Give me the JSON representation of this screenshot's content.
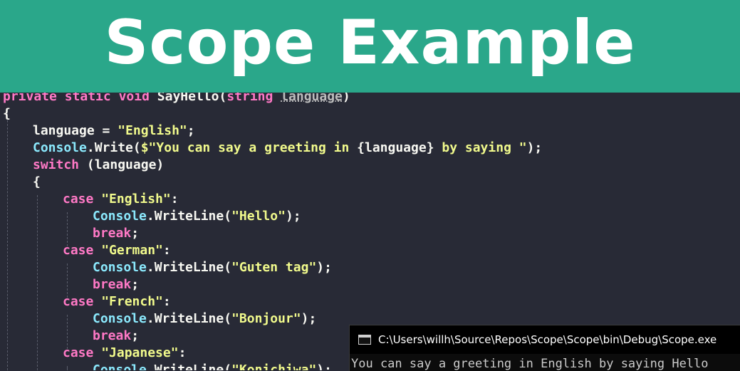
{
  "banner": {
    "title": "Scope Example"
  },
  "code": {
    "l1": {
      "a": "private",
      "b": "static",
      "c": "void",
      "d": "SayHello",
      "e": "(",
      "f": "string",
      "g": "language",
      "h": ")"
    },
    "l2": "{",
    "l3": {
      "a": "language = ",
      "b": "\"English\"",
      "c": ";"
    },
    "l4": {
      "a": "Console",
      "b": ".Write(",
      "c": "$\"You can say a greeting in ",
      "d": "{language}",
      "e": " by saying \"",
      "f": ");"
    },
    "l5": {
      "a": "switch",
      "b": " (language)"
    },
    "l6": "{",
    "l7": {
      "a": "case",
      "b": "\"English\"",
      "c": ":"
    },
    "l8": {
      "a": "Console",
      "b": ".WriteLine(",
      "c": "\"Hello\"",
      "d": ");"
    },
    "l9": {
      "a": "break",
      "b": ";"
    },
    "l10": {
      "a": "case",
      "b": "\"German\"",
      "c": ":"
    },
    "l11": {
      "a": "Console",
      "b": ".WriteLine(",
      "c": "\"Guten tag\"",
      "d": ");"
    },
    "l12": {
      "a": "break",
      "b": ";"
    },
    "l13": {
      "a": "case",
      "b": "\"French\"",
      "c": ":"
    },
    "l14": {
      "a": "Console",
      "b": ".WriteLine(",
      "c": "\"Bonjour\"",
      "d": ");"
    },
    "l15": {
      "a": "break",
      "b": ";"
    },
    "l16": {
      "a": "case",
      "b": "\"Japanese\"",
      "c": ":"
    },
    "l17": {
      "a": "Console",
      "b": ".WriteLine(",
      "c": "\"Konichiwa\"",
      "d": ");"
    }
  },
  "console": {
    "icon": "console-window-icon",
    "title": "C:\\Users\\willh\\Source\\Repos\\Scope\\Scope\\bin\\Debug\\Scope.exe",
    "output": "You can say a greeting in English by saying Hello"
  },
  "colors": {
    "banner": "#2aa78a",
    "editor_bg": "#282a36",
    "keyword": "#ff79c6",
    "type": "#8be9fd",
    "string": "#f1fa8c"
  }
}
